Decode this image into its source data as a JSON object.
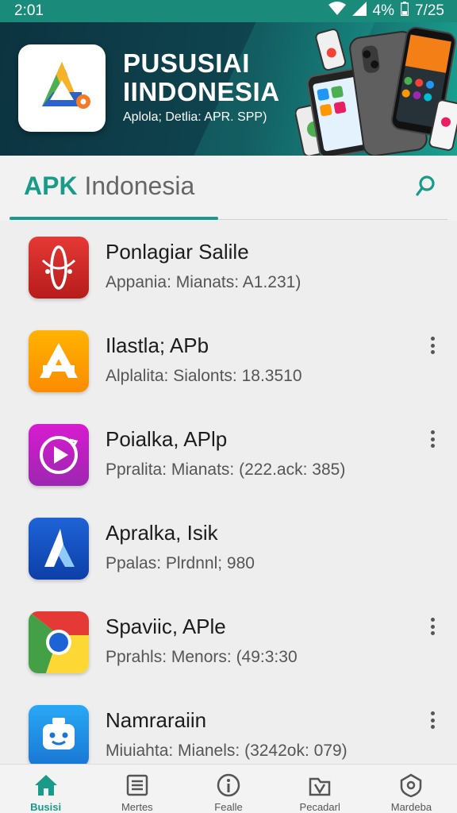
{
  "status_bar": {
    "time": "2:01",
    "battery": "4%",
    "right_time": "7/25"
  },
  "banner": {
    "title_line1": "PUSUSIAI",
    "title_line2": "IINDONESIA",
    "subtitle": "Aplola; Detlia: APR. SPP)"
  },
  "header": {
    "title_accent": "APK",
    "title_rest": " Indonesia"
  },
  "apps": [
    {
      "name": "Ponlagiar Salile",
      "meta": "Appania: Mianats:  A1.231)",
      "icon": "app-icon-red",
      "has_menu": false
    },
    {
      "name": "Ilastla; APb",
      "meta": "Alplalita: Sialonts: 18.3510",
      "icon": "app-icon-orange",
      "has_menu": true
    },
    {
      "name": "Poialka, APlp",
      "meta": "Ppralita: Mianats: (222.ack: 385)",
      "icon": "app-icon-purple-play",
      "has_menu": true
    },
    {
      "name": "Apralka, Isik",
      "meta": "Ppalas: Plrdnnl; 980",
      "icon": "app-icon-blue",
      "has_menu": false
    },
    {
      "name": "Spaviic, APle",
      "meta": "Pprahls: Menors: (49:3:30",
      "icon": "chrome-icon",
      "has_menu": true
    },
    {
      "name": "Namraraiin",
      "meta": "Miuiahta: Mianels: (3242ok: 079)",
      "icon": "app-icon-robot",
      "has_menu": true
    }
  ],
  "nav": {
    "items": [
      {
        "label": "Busisi",
        "icon": "home-icon",
        "active": true
      },
      {
        "label": "Mertes",
        "icon": "list-icon",
        "active": false
      },
      {
        "label": "Fealle",
        "icon": "info-icon",
        "active": false
      },
      {
        "label": "Pecadarl",
        "icon": "download-icon",
        "active": false
      },
      {
        "label": "Mardeba",
        "icon": "shield-icon",
        "active": false
      }
    ]
  },
  "colors": {
    "accent": "#1a9a88",
    "status_bar": "#1a8a7a",
    "banner_dark": "#0c3340"
  }
}
